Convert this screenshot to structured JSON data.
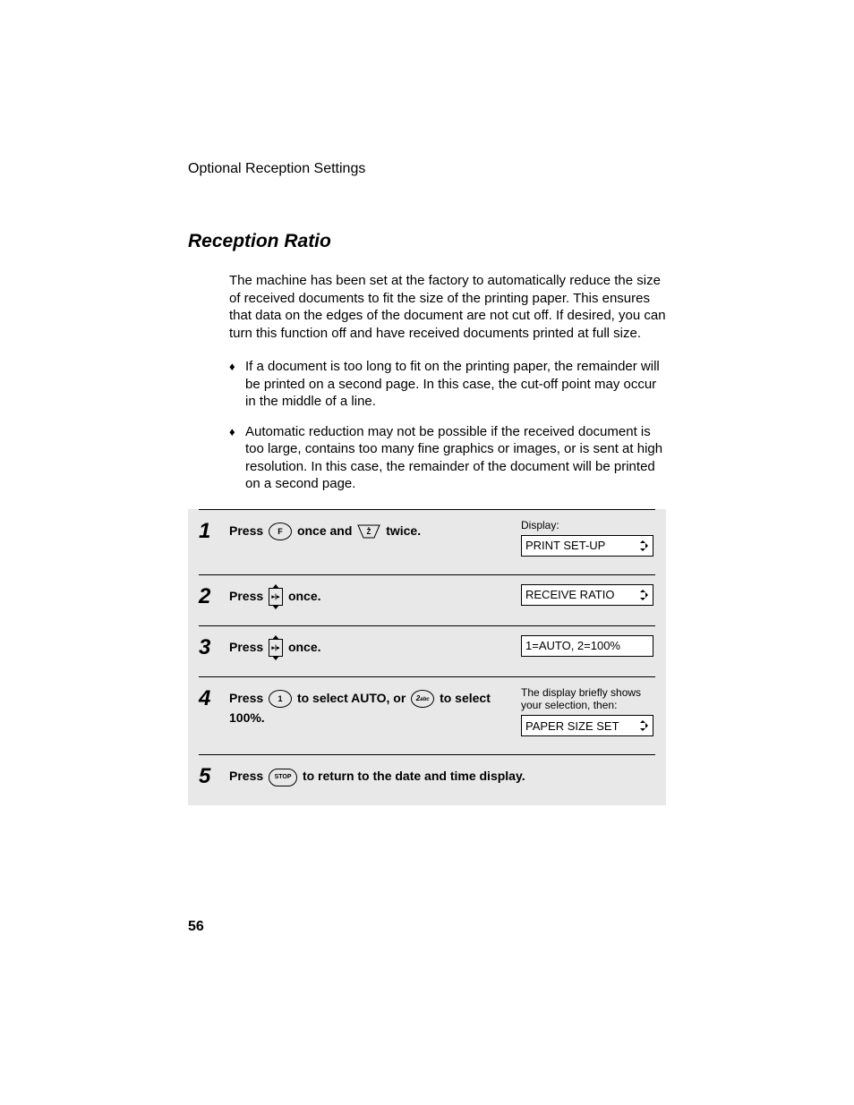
{
  "section_header": "Optional Reception Settings",
  "title": "Reception Ratio",
  "intro": "The machine has been set at the factory to automatically reduce the size of received documents to fit the size of the printing paper. This ensures that data on the edges of the document are not cut off. If desired, you can turn this function off and have received documents printed at full size.",
  "bullets": [
    "If a document is too long to fit on the printing paper, the remainder will be printed on a second page. In this case, the cut-off point may occur in the middle of a line.",
    "Automatic reduction may not be possible if the received document is too large, contains too many fine graphics or images, or is sent at high resolution. In this case, the remainder of the document will be printed on a second page."
  ],
  "display_label": "Display:",
  "steps": [
    {
      "num": "1",
      "parts": [
        "Press ",
        "F",
        " once and ",
        "Z",
        " twice."
      ],
      "display": "PRINT SET-UP",
      "arrows": true
    },
    {
      "num": "2",
      "parts": [
        "Press ",
        "DIR",
        " once."
      ],
      "display": "RECEIVE RATIO",
      "arrows": true
    },
    {
      "num": "3",
      "parts": [
        "Press ",
        "DIR",
        " once."
      ],
      "display": "1=AUTO, 2=100%",
      "arrows": false
    },
    {
      "num": "4",
      "parts": [
        "Press ",
        "1",
        " to select AUTO, or ",
        "2",
        " to select 100%."
      ],
      "note": "The display briefly shows your selection, then:",
      "display": "PAPER SIZE SET",
      "arrows": true
    },
    {
      "num": "5",
      "parts": [
        "Press ",
        "STOP",
        " to return to the date and time display."
      ]
    }
  ],
  "keys": {
    "F": "F",
    "Z": "Z",
    "1": "1",
    "2": "2 abc",
    "STOP": "STOP",
    "DIR_LEFT": "◂",
    "DIR_RIGHT": "▸"
  },
  "page_number": "56"
}
